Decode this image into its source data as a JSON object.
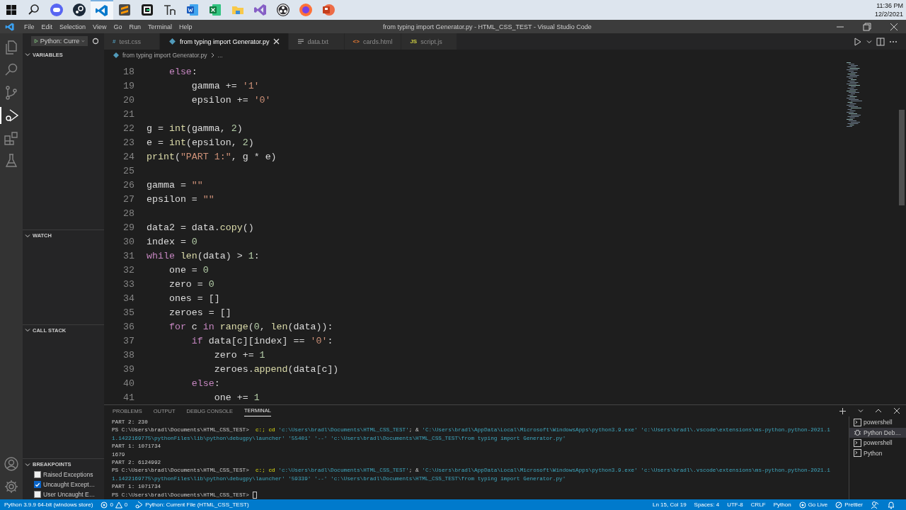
{
  "taskbar": {
    "items": [
      {
        "kind": "start",
        "selected": false
      },
      {
        "kind": "search",
        "selected": false
      },
      {
        "kind": "chat",
        "selected": false
      },
      {
        "kind": "steam",
        "selected": false
      },
      {
        "kind": "code",
        "selected": true
      },
      {
        "kind": "sublime",
        "selected": false
      },
      {
        "kind": "gdevelop",
        "selected": false
      },
      {
        "kind": "font",
        "selected": false
      },
      {
        "kind": "word",
        "selected": false
      },
      {
        "kind": "excel",
        "selected": false
      },
      {
        "kind": "folder",
        "selected": false
      },
      {
        "kind": "studio",
        "selected": false
      },
      {
        "kind": "obs",
        "selected": false
      },
      {
        "kind": "browser",
        "selected": false
      },
      {
        "kind": "slides",
        "selected": false
      }
    ],
    "time": "11:36 PM",
    "date": "12/2/2021"
  },
  "window": {
    "title": "from typing import Generator.py - HTML_CSS_TEST - Visual Studio Code",
    "menu": [
      "File",
      "Edit",
      "Selection",
      "View",
      "Go",
      "Run",
      "Terminal",
      "Help"
    ]
  },
  "activity_bar": [
    {
      "kind": "explorer",
      "selected": false
    },
    {
      "kind": "search",
      "selected": false
    },
    {
      "kind": "source-control",
      "selected": false
    },
    {
      "kind": "debug",
      "selected": true
    },
    {
      "kind": "extensions",
      "selected": false
    },
    {
      "kind": "testing",
      "selected": false
    }
  ],
  "sidebar": {
    "launch_config": "Python: Curre",
    "sections": [
      {
        "title": "VARIABLES",
        "expanded": true
      },
      {
        "title": "WATCH",
        "expanded": true
      },
      {
        "title": "CALL STACK",
        "expanded": true
      },
      {
        "title": "BREAKPOINTS",
        "expanded": true,
        "items": [
          {
            "label": "Raised Exceptions",
            "checked": false
          },
          {
            "label": "Uncaught Except…",
            "checked": true
          },
          {
            "label": "User Uncaught E…",
            "checked": false
          }
        ]
      }
    ]
  },
  "tabs": [
    {
      "kind": "css",
      "glyph": "#",
      "label": "test.css",
      "selected": false
    },
    {
      "kind": "python",
      "label": "from typing import Generator.py",
      "selected": true
    },
    {
      "kind": "text",
      "label": "data.txt",
      "selected": false
    },
    {
      "kind": "html",
      "glyph": "<>",
      "label": "cards.html",
      "selected": false
    },
    {
      "kind": "js",
      "glyph": "JS",
      "label": "script.js",
      "selected": false
    }
  ],
  "breadcrumb": [
    "from typing import Generator.py",
    "..."
  ],
  "code": [
    {
      "n": "18",
      "tokens": [
        {
          "kind": "kw",
          "text": "    else"
        },
        {
          "kind": "op",
          "text": ":"
        }
      ]
    },
    {
      "n": "19",
      "tokens": [
        {
          "kind": "var",
          "text": "        gamma"
        },
        {
          "kind": "op",
          "text": " += "
        },
        {
          "kind": "str",
          "text": "'1'"
        }
      ]
    },
    {
      "n": "20",
      "tokens": [
        {
          "kind": "var",
          "text": "        epsilon"
        },
        {
          "kind": "op",
          "text": " += "
        },
        {
          "kind": "str",
          "text": "'0'"
        }
      ]
    },
    {
      "n": "21"
    },
    {
      "n": "22",
      "tokens": [
        {
          "kind": "var",
          "text": "g"
        },
        {
          "kind": "op",
          "text": " = "
        },
        {
          "kind": "fn",
          "text": "int"
        },
        {
          "kind": "op",
          "text": "("
        },
        {
          "kind": "var",
          "text": "gamma"
        },
        {
          "kind": "op",
          "text": ", "
        },
        {
          "kind": "num",
          "text": "2"
        },
        {
          "kind": "op",
          "text": ")"
        }
      ]
    },
    {
      "n": "23",
      "tokens": [
        {
          "kind": "var",
          "text": "e"
        },
        {
          "kind": "op",
          "text": " = "
        },
        {
          "kind": "fn",
          "text": "int"
        },
        {
          "kind": "op",
          "text": "("
        },
        {
          "kind": "var",
          "text": "epsilon"
        },
        {
          "kind": "op",
          "text": ", "
        },
        {
          "kind": "num",
          "text": "2"
        },
        {
          "kind": "op",
          "text": ")"
        }
      ]
    },
    {
      "n": "24",
      "tokens": [
        {
          "kind": "fn",
          "text": "print"
        },
        {
          "kind": "op",
          "text": "("
        },
        {
          "kind": "str",
          "text": "\"PART 1:\""
        },
        {
          "kind": "op",
          "text": ", "
        },
        {
          "kind": "var",
          "text": "g"
        },
        {
          "kind": "op",
          "text": " * "
        },
        {
          "kind": "var",
          "text": "e"
        },
        {
          "kind": "op",
          "text": ")"
        }
      ]
    },
    {
      "n": "25"
    },
    {
      "n": "26",
      "tokens": [
        {
          "kind": "var",
          "text": "gamma"
        },
        {
          "kind": "op",
          "text": " = "
        },
        {
          "kind": "str",
          "text": "\"\""
        }
      ]
    },
    {
      "n": "27",
      "tokens": [
        {
          "kind": "var",
          "text": "epsilon"
        },
        {
          "kind": "op",
          "text": " = "
        },
        {
          "kind": "str",
          "text": "\"\""
        }
      ]
    },
    {
      "n": "28"
    },
    {
      "n": "29",
      "tokens": [
        {
          "kind": "var",
          "text": "data2"
        },
        {
          "kind": "op",
          "text": " = "
        },
        {
          "kind": "var",
          "text": "data"
        },
        {
          "kind": "op",
          "text": "."
        },
        {
          "kind": "fn",
          "text": "copy"
        },
        {
          "kind": "op",
          "text": "()"
        }
      ]
    },
    {
      "n": "30",
      "tokens": [
        {
          "kind": "var",
          "text": "index"
        },
        {
          "kind": "op",
          "text": " = "
        },
        {
          "kind": "num",
          "text": "0"
        }
      ]
    },
    {
      "n": "31",
      "tokens": [
        {
          "kind": "kw",
          "text": "while"
        },
        {
          "kind": "fn",
          "text": " len"
        },
        {
          "kind": "op",
          "text": "("
        },
        {
          "kind": "var",
          "text": "data"
        },
        {
          "kind": "op",
          "text": ") > "
        },
        {
          "kind": "num",
          "text": "1"
        },
        {
          "kind": "op",
          "text": ":"
        }
      ]
    },
    {
      "n": "32",
      "tokens": [
        {
          "kind": "var",
          "text": "    one"
        },
        {
          "kind": "op",
          "text": " = "
        },
        {
          "kind": "num",
          "text": "0"
        }
      ]
    },
    {
      "n": "33",
      "tokens": [
        {
          "kind": "var",
          "text": "    zero"
        },
        {
          "kind": "op",
          "text": " = "
        },
        {
          "kind": "num",
          "text": "0"
        }
      ]
    },
    {
      "n": "34",
      "tokens": [
        {
          "kind": "var",
          "text": "    ones"
        },
        {
          "kind": "op",
          "text": " = []"
        }
      ]
    },
    {
      "n": "35",
      "tokens": [
        {
          "kind": "var",
          "text": "    zeroes"
        },
        {
          "kind": "op",
          "text": " = []"
        }
      ]
    },
    {
      "n": "36",
      "tokens": [
        {
          "kind": "kw",
          "text": "    for"
        },
        {
          "kind": "var",
          "text": " c"
        },
        {
          "kind": "kw",
          "text": " in"
        },
        {
          "kind": "fn",
          "text": " range"
        },
        {
          "kind": "op",
          "text": "("
        },
        {
          "kind": "num",
          "text": "0"
        },
        {
          "kind": "op",
          "text": ", "
        },
        {
          "kind": "fn",
          "text": "len"
        },
        {
          "kind": "op",
          "text": "("
        },
        {
          "kind": "var",
          "text": "data"
        },
        {
          "kind": "op",
          "text": ")):"
        }
      ]
    },
    {
      "n": "37",
      "tokens": [
        {
          "kind": "kw",
          "text": "        if"
        },
        {
          "kind": "var",
          "text": " data"
        },
        {
          "kind": "op",
          "text": "["
        },
        {
          "kind": "var",
          "text": "c"
        },
        {
          "kind": "op",
          "text": "]["
        },
        {
          "kind": "var",
          "text": "index"
        },
        {
          "kind": "op",
          "text": "] == "
        },
        {
          "kind": "str",
          "text": "'0'"
        },
        {
          "kind": "op",
          "text": ":"
        }
      ]
    },
    {
      "n": "38",
      "tokens": [
        {
          "kind": "var",
          "text": "            zero"
        },
        {
          "kind": "op",
          "text": " += "
        },
        {
          "kind": "num",
          "text": "1"
        }
      ]
    },
    {
      "n": "39",
      "tokens": [
        {
          "kind": "var",
          "text": "            zeroes"
        },
        {
          "kind": "op",
          "text": "."
        },
        {
          "kind": "fn",
          "text": "append"
        },
        {
          "kind": "op",
          "text": "("
        },
        {
          "kind": "var",
          "text": "data"
        },
        {
          "kind": "op",
          "text": "["
        },
        {
          "kind": "var",
          "text": "c"
        },
        {
          "kind": "op",
          "text": "])"
        }
      ]
    },
    {
      "n": "40",
      "tokens": [
        {
          "kind": "kw",
          "text": "        else"
        },
        {
          "kind": "op",
          "text": ":"
        }
      ]
    },
    {
      "n": "41",
      "tokens": [
        {
          "kind": "var",
          "text": "            one"
        },
        {
          "kind": "op",
          "text": " += "
        },
        {
          "kind": "num",
          "text": "1"
        }
      ]
    }
  ],
  "panel": {
    "tabs": [
      {
        "label": "PROBLEMS",
        "selected": false
      },
      {
        "label": "OUTPUT",
        "selected": false
      },
      {
        "label": "DEBUG CONSOLE",
        "selected": false
      },
      {
        "label": "TERMINAL",
        "selected": true
      }
    ],
    "terminal": [
      {
        "tokens": [
          {
            "kind": "text",
            "text": "PART 2: 230"
          }
        ]
      },
      {
        "tokens": [
          {
            "kind": "text",
            "text": "PS C:\\Users\\bradl\\Documents\\HTML_CSS_TEST>  "
          },
          {
            "kind": "cmd",
            "text": "c:; cd"
          },
          {
            "kind": "str",
            "text": " 'c:\\Users\\bradl\\Documents\\HTML_CSS_TEST'"
          },
          {
            "kind": "text",
            "text": "; & "
          },
          {
            "kind": "str",
            "text": "'C:\\Users\\bradl\\AppData\\Local\\Microsoft\\WindowsApps\\python3.9.exe' 'c:\\Users\\bradl\\.vscode\\extensions\\ms-python.python-2021.1"
          }
        ]
      },
      {
        "tokens": [
          {
            "kind": "str",
            "text": "1.1422169775\\pythonFiles\\lib\\python\\debugpy\\launcher' '55401' '--' 'c:\\Users\\bradl\\Documents\\HTML_CSS_TEST\\from typing import Generator.py'"
          }
        ]
      },
      {
        "tokens": [
          {
            "kind": "text",
            "text": "PART 1: 1071734"
          }
        ]
      },
      {
        "tokens": [
          {
            "kind": "text",
            "text": "1679"
          }
        ]
      },
      {
        "tokens": [
          {
            "kind": "text",
            "text": "PART 2: 6124992"
          }
        ]
      },
      {
        "tokens": [
          {
            "kind": "text",
            "text": "PS C:\\Users\\bradl\\Documents\\HTML_CSS_TEST>  "
          },
          {
            "kind": "cmd",
            "text": "c:; cd"
          },
          {
            "kind": "str",
            "text": " 'c:\\Users\\bradl\\Documents\\HTML_CSS_TEST'"
          },
          {
            "kind": "text",
            "text": "; & "
          },
          {
            "kind": "str",
            "text": "'C:\\Users\\bradl\\AppData\\Local\\Microsoft\\WindowsApps\\python3.9.exe' 'c:\\Users\\bradl\\.vscode\\extensions\\ms-python.python-2021.1"
          }
        ]
      },
      {
        "tokens": [
          {
            "kind": "str",
            "text": "1.1422169775\\pythonFiles\\lib\\python\\debugpy\\launcher' '59339' '--' 'c:\\Users\\bradl\\Documents\\HTML_CSS_TEST\\from typing import Generator.py'"
          }
        ]
      },
      {
        "tokens": [
          {
            "kind": "text",
            "text": "PART 1: 1071734"
          }
        ]
      },
      {
        "tokens": [
          {
            "kind": "text",
            "text": "PS C:\\Users\\bradl\\Documents\\HTML_CSS_TEST>"
          }
        ],
        "cursor": true
      }
    ],
    "terminals": [
      {
        "kind": "shell",
        "label": "powershell",
        "selected": false
      },
      {
        "kind": "debug",
        "label": "Python Deb…",
        "selected": true
      },
      {
        "kind": "shell",
        "label": "powershell",
        "selected": false
      },
      {
        "kind": "shell",
        "label": "Python",
        "selected": false
      }
    ]
  },
  "status_bar": {
    "left": [
      {
        "kind": "text",
        "text": "Python 3.9.9 64-bit (windows store)"
      },
      {
        "kind": "problems",
        "errors": "0",
        "warnings": "0"
      },
      {
        "kind": "debug",
        "text": "Python: Current File (HTML_CSS_TEST)"
      }
    ],
    "right": [
      {
        "kind": "text",
        "text": "Ln 15, Col 19"
      },
      {
        "kind": "text",
        "text": "Spaces: 4"
      },
      {
        "kind": "text",
        "text": "UTF-8"
      },
      {
        "kind": "text",
        "text": "CRLF"
      },
      {
        "kind": "text",
        "text": "Python"
      },
      {
        "kind": "golive",
        "text": "Go Live"
      },
      {
        "kind": "prettier",
        "text": "Prettier"
      },
      {
        "kind": "feedback"
      },
      {
        "kind": "bell"
      }
    ]
  }
}
